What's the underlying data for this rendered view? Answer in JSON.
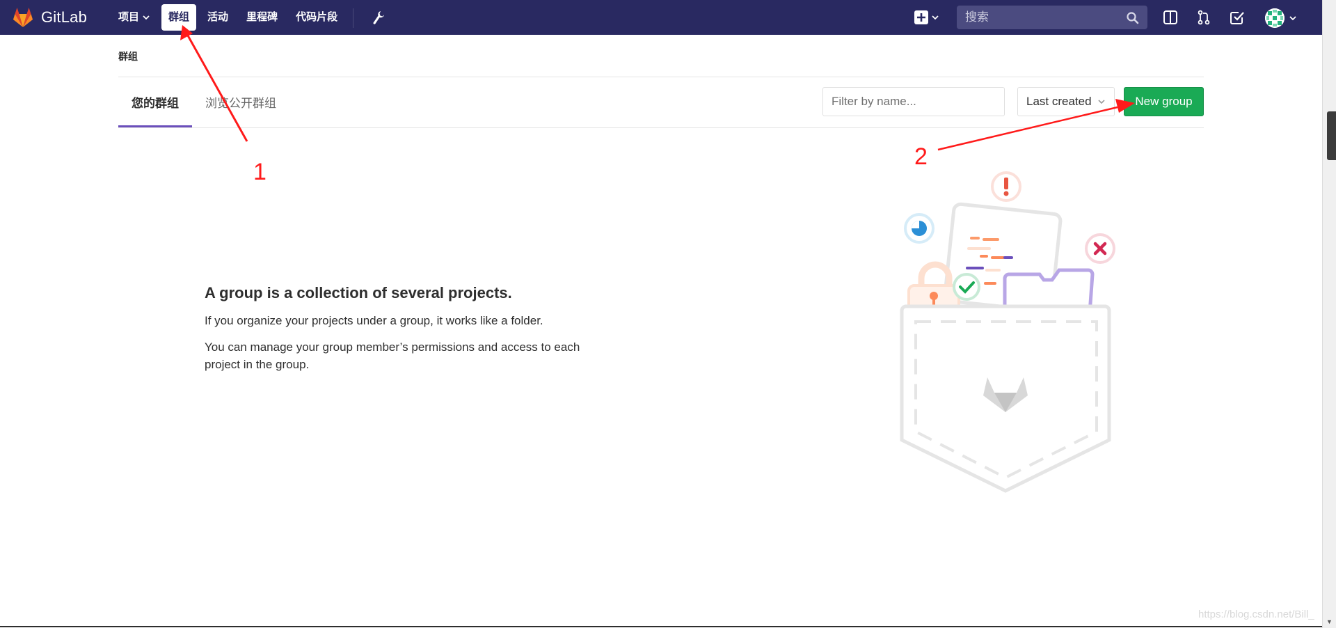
{
  "navbar": {
    "brand": "GitLab",
    "links": [
      {
        "label": "项目",
        "has_dropdown": true
      },
      {
        "label": "群组",
        "active": true
      },
      {
        "label": "活动"
      },
      {
        "label": "里程碑"
      },
      {
        "label": "代码片段"
      }
    ],
    "search_placeholder": "搜索"
  },
  "breadcrumb": "群组",
  "tabs": [
    {
      "label": "您的群组",
      "active": true
    },
    {
      "label": "浏览公开群组"
    }
  ],
  "filter_placeholder": "Filter by name...",
  "sort_selected": "Last created",
  "new_group_label": "New group",
  "empty_state": {
    "title": "A group is a collection of several projects.",
    "line1": "If you organize your projects under a group, it works like a folder.",
    "line2": "You can manage your group member’s permissions and access to each project in the group."
  },
  "annotations": [
    "1",
    "2"
  ],
  "watermark": "https://blog.csdn.net/Bill_",
  "colors": {
    "navbar_bg": "#292961",
    "active_tab_underline": "#6b4fbb",
    "new_group_button": "#1aaa55",
    "annotation_red": "#ff1a1a"
  }
}
